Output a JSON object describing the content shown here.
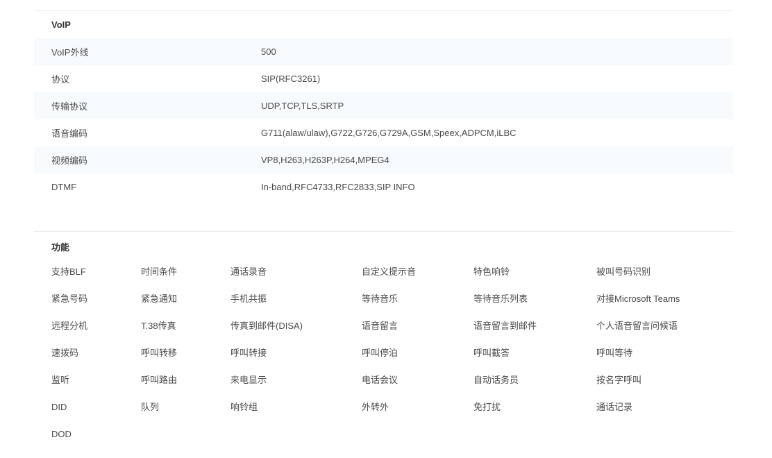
{
  "voip": {
    "title": "VoIP",
    "rows": [
      {
        "label": "VoIP外线",
        "value": "500"
      },
      {
        "label": "协议",
        "value": "SIP(RFC3261)"
      },
      {
        "label": "传输协议",
        "value": "UDP,TCP,TLS,SRTP"
      },
      {
        "label": "语音编码",
        "value": "G711(alaw/ulaw),G722,G726,G729A,GSM,Speex,ADPCM,iLBC"
      },
      {
        "label": "视频编码",
        "value": "VP8,H263,H263P,H264,MPEG4"
      },
      {
        "label": "DTMF",
        "value": "In-band,RFC4733,RFC2833,SIP INFO"
      }
    ]
  },
  "features": {
    "title": "功能",
    "rows": [
      [
        "支持BLF",
        "时间条件",
        "通话录音",
        "自定义提示音",
        "特色响铃",
        "被叫号码识别"
      ],
      [
        "紧急号码",
        "紧急通知",
        "手机共振",
        "等待音乐",
        "等待音乐列表",
        "对接Microsoft Teams"
      ],
      [
        "远程分机",
        "T.38传真",
        "传真到邮件(DISA)",
        "语音留言",
        "语音留言到邮件",
        "个人语音留言问候语"
      ],
      [
        "速拨码",
        "呼叫转移",
        "呼叫转接",
        "呼叫停泊",
        "呼叫截答",
        "呼叫等待"
      ],
      [
        "监听",
        "呼叫路由",
        "来电显示",
        "电话会议",
        "自动话务员",
        "按名字呼叫"
      ],
      [
        "DID",
        "队列",
        "响铃组",
        "外转外",
        "免打扰",
        "通话记录"
      ],
      [
        "DOD"
      ]
    ]
  },
  "colors": {
    "row_shade": "#f7fbfd",
    "divider": "#ececec",
    "text": "#4a4a4a"
  }
}
